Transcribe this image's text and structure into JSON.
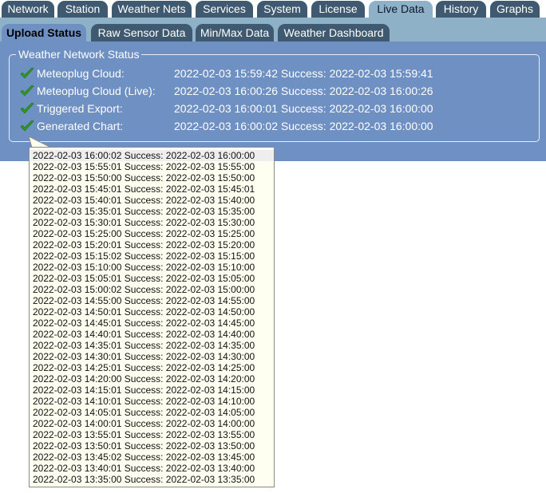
{
  "tabs": [
    {
      "label": "Network",
      "active": false
    },
    {
      "label": "Station",
      "active": false
    },
    {
      "label": "Weather Nets",
      "active": false
    },
    {
      "label": "Services",
      "active": false
    },
    {
      "label": "System",
      "active": false
    },
    {
      "label": "License",
      "active": false
    },
    {
      "label": "Live Data",
      "active": true
    },
    {
      "label": "History",
      "active": false
    },
    {
      "label": "Graphs",
      "active": false
    }
  ],
  "subtabs": [
    {
      "label": "Upload Status",
      "active": true
    },
    {
      "label": "Raw Sensor Data",
      "active": false
    },
    {
      "label": "Min/Max Data",
      "active": false
    },
    {
      "label": "Weather Dashboard",
      "active": false
    }
  ],
  "status": {
    "legend": "Weather Network Status",
    "rows": [
      {
        "name": "Meteoplug Cloud:",
        "value": "2022-02-03 15:59:42 Success: 2022-02-03 15:59:41",
        "icon": "check-icon"
      },
      {
        "name": "Meteoplug Cloud (Live):",
        "value": "2022-02-03 16:00:26 Success: 2022-02-03 16:00:26",
        "icon": "check-icon"
      },
      {
        "name": "Triggered Export:",
        "value": "2022-02-03 16:00:01 Success: 2022-02-03 16:00:00",
        "icon": "check-icon"
      },
      {
        "name": "Generated Chart:",
        "value": "2022-02-03 16:00:02 Success: 2022-02-03 16:00:00",
        "icon": "check-icon"
      }
    ]
  },
  "history": [
    "2022-02-03 16:00:02 Success: 2022-02-03 16:00:00",
    "2022-02-03 15:55:01 Success: 2022-02-03 15:55:00",
    "2022-02-03 15:50:00 Success: 2022-02-03 15:50:00",
    "2022-02-03 15:45:01 Success: 2022-02-03 15:45:01",
    "2022-02-03 15:40:01 Success: 2022-02-03 15:40:00",
    "2022-02-03 15:35:01 Success: 2022-02-03 15:35:00",
    "2022-02-03 15:30:01 Success: 2022-02-03 15:30:00",
    "2022-02-03 15:25:00 Success: 2022-02-03 15:25:00",
    "2022-02-03 15:20:01 Success: 2022-02-03 15:20:00",
    "2022-02-03 15:15:02 Success: 2022-02-03 15:15:00",
    "2022-02-03 15:10:00 Success: 2022-02-03 15:10:00",
    "2022-02-03 15:05:01 Success: 2022-02-03 15:05:00",
    "2022-02-03 15:00:02 Success: 2022-02-03 15:00:00",
    "2022-02-03 14:55:00 Success: 2022-02-03 14:55:00",
    "2022-02-03 14:50:01 Success: 2022-02-03 14:50:00",
    "2022-02-03 14:45:01 Success: 2022-02-03 14:45:00",
    "2022-02-03 14:40:01 Success: 2022-02-03 14:40:00",
    "2022-02-03 14:35:01 Success: 2022-02-03 14:35:00",
    "2022-02-03 14:30:01 Success: 2022-02-03 14:30:00",
    "2022-02-03 14:25:01 Success: 2022-02-03 14:25:00",
    "2022-02-03 14:20:00 Success: 2022-02-03 14:20:00",
    "2022-02-03 14:15:01 Success: 2022-02-03 14:15:00",
    "2022-02-03 14:10:01 Success: 2022-02-03 14:10:00",
    "2022-02-03 14:05:01 Success: 2022-02-03 14:05:00",
    "2022-02-03 14:00:01 Success: 2022-02-03 14:00:00",
    "2022-02-03 13:55:01 Success: 2022-02-03 13:55:00",
    "2022-02-03 13:50:01 Success: 2022-02-03 13:50:00",
    "2022-02-03 13:45:02 Success: 2022-02-03 13:45:00",
    "2022-02-03 13:40:01 Success: 2022-02-03 13:40:00",
    "2022-02-03 13:35:00 Success: 2022-02-03 13:35:00"
  ],
  "colors": {
    "tab": "#3f5a70",
    "tab_active": "#8fb1c8",
    "panel": "#6f90c2",
    "check": "#2f9b22",
    "popup_bg": "#fefff0"
  }
}
